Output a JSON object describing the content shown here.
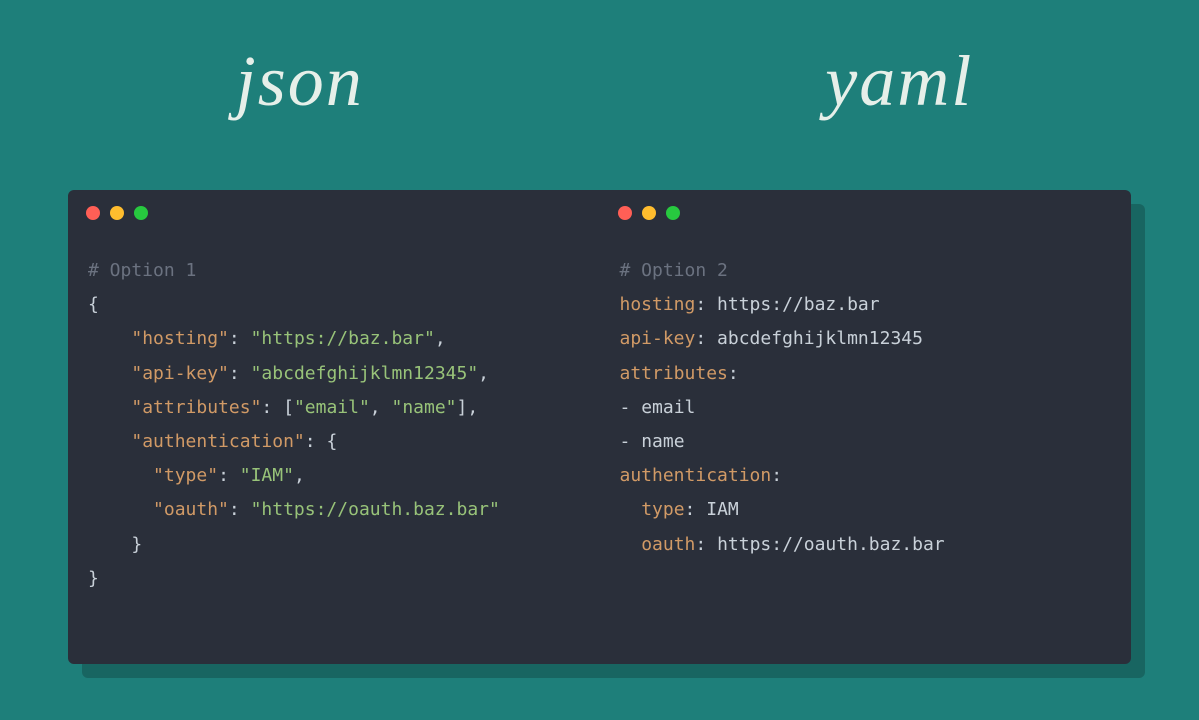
{
  "titles": {
    "left": "json",
    "right": "yaml"
  },
  "json_pane": {
    "comment": "# Option 1",
    "indent1": "    ",
    "indent2": "      ",
    "keys": {
      "hosting": "\"hosting\"",
      "apikey": "\"api-key\"",
      "attributes": "\"attributes\"",
      "authentication": "\"authentication\"",
      "type": "\"type\"",
      "oauth": "\"oauth\""
    },
    "vals": {
      "hosting": "\"https://baz.bar\"",
      "apikey": "\"abcdefghijklmn12345\"",
      "attr_email": "\"email\"",
      "attr_name": "\"name\"",
      "type": "\"IAM\"",
      "oauth": "\"https://oauth.baz.bar\""
    },
    "p": {
      "open_brace": "{",
      "close_brace": "}",
      "colon_sp": ": ",
      "comma": ",",
      "lbracket": "[",
      "rbracket": "]",
      "comma_sp": ", "
    }
  },
  "yaml_pane": {
    "comment": "# Option 2",
    "indent1": "  ",
    "keys": {
      "hosting": "hosting",
      "apikey": "api-key",
      "attributes": "attributes",
      "authentication": "authentication",
      "type": "type",
      "oauth": "oauth"
    },
    "vals": {
      "hosting": "https://baz.bar",
      "apikey": "abcdefghijklmn12345",
      "email": "email",
      "name": "name",
      "type": "IAM",
      "oauth": "https://oauth.baz.bar"
    },
    "p": {
      "colon_sp": ": ",
      "colon": ":",
      "dash_sp": "- "
    }
  }
}
